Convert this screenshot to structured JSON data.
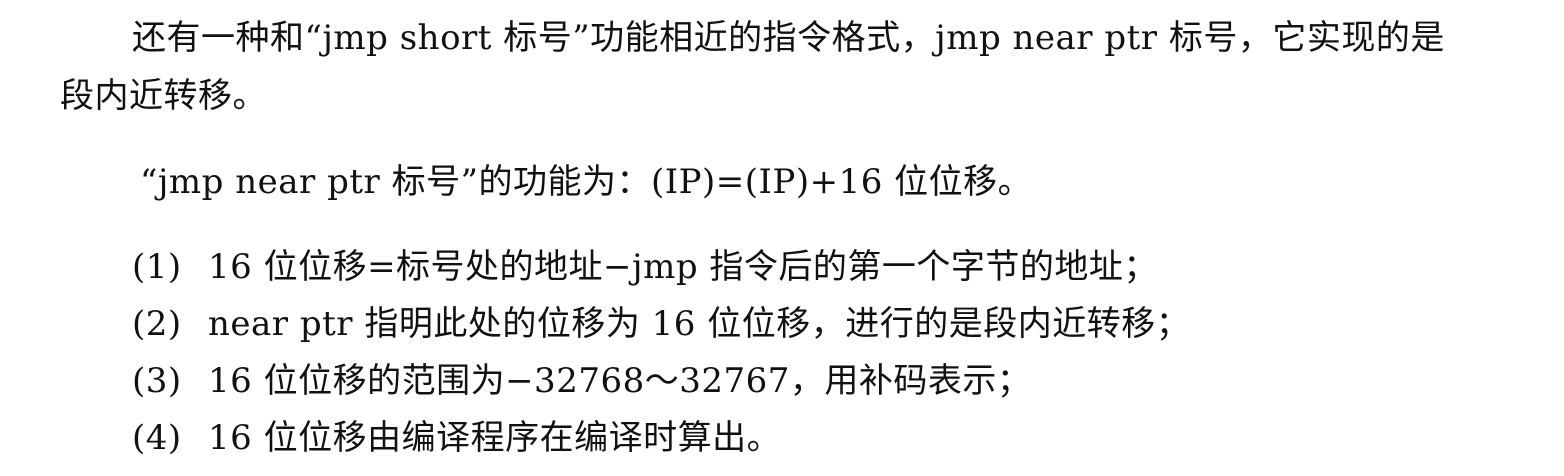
{
  "paragraph1": {
    "line1": "还有一种和“jmp short 标号”功能相近的指令格式，jmp near ptr 标号，它实现的是",
    "line2": "段内近转移。"
  },
  "paragraph2": "“jmp near ptr 标号”的功能为：(IP)=(IP)+16 位位移。",
  "list": [
    {
      "num": "(1)",
      "text": "16 位位移=标号处的地址−jmp 指令后的第一个字节的地址；"
    },
    {
      "num": "(2)",
      "text": "near ptr 指明此处的位移为 16 位位移，进行的是段内近转移；"
    },
    {
      "num": "(3)",
      "text": "16 位位移的范围为−32768～32767，用补码表示；"
    },
    {
      "num": "(4)",
      "text": "16 位位移由编译程序在编译时算出。"
    }
  ]
}
